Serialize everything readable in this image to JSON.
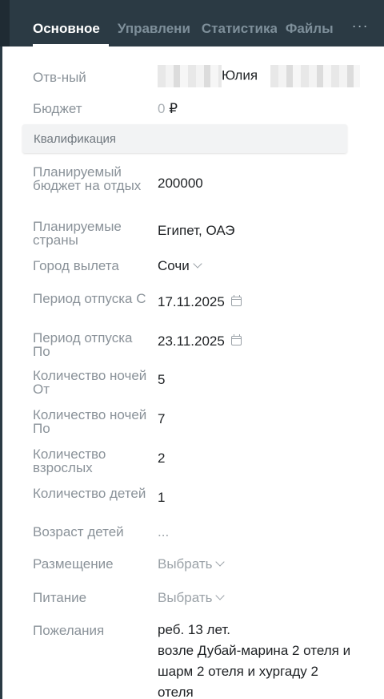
{
  "tabs": [
    {
      "label": "Основное",
      "active": true
    },
    {
      "label": "Управлени",
      "active": false
    },
    {
      "label": "Статистика",
      "active": false
    },
    {
      "label": "Файлы",
      "active": false
    }
  ],
  "more_label": "···",
  "responsible": {
    "label": "Отв-ный",
    "name": "Юлия"
  },
  "budget": {
    "label": "Бюджет",
    "amount": "0",
    "currency": "₽"
  },
  "section_title": "Квалификация",
  "fields": {
    "planned_budget": {
      "label": "Планируемый бюджет на отдых",
      "value": "200000"
    },
    "countries": {
      "label": "Планируемые страны",
      "value": "Египет, ОАЭ"
    },
    "departure_city": {
      "label": "Город вылета",
      "value": "Сочи"
    },
    "period_from": {
      "label": "Период отпуска С",
      "value": "17.11.2025"
    },
    "period_to": {
      "label": "Период отпуска По",
      "value": "23.11.2025"
    },
    "nights_from": {
      "label": "Количество ночей От",
      "value": "5"
    },
    "nights_to": {
      "label": "Количество ночей По",
      "value": "7"
    },
    "adults": {
      "label": "Количество взрослых",
      "value": "2"
    },
    "children": {
      "label": "Количество детей",
      "value": "1"
    },
    "children_age": {
      "label": "Возраст детей",
      "value": "..."
    },
    "accommodation": {
      "label": "Размещение",
      "value": "Выбрать"
    },
    "meals": {
      "label": "Питание",
      "value": "Выбрать"
    },
    "wishes": {
      "label": "Пожелания",
      "value": "реб. 13 лет.\nвозле Дубай-марина 2 отеля и шарм 2 отеля и хургаду 2 отеля"
    }
  }
}
